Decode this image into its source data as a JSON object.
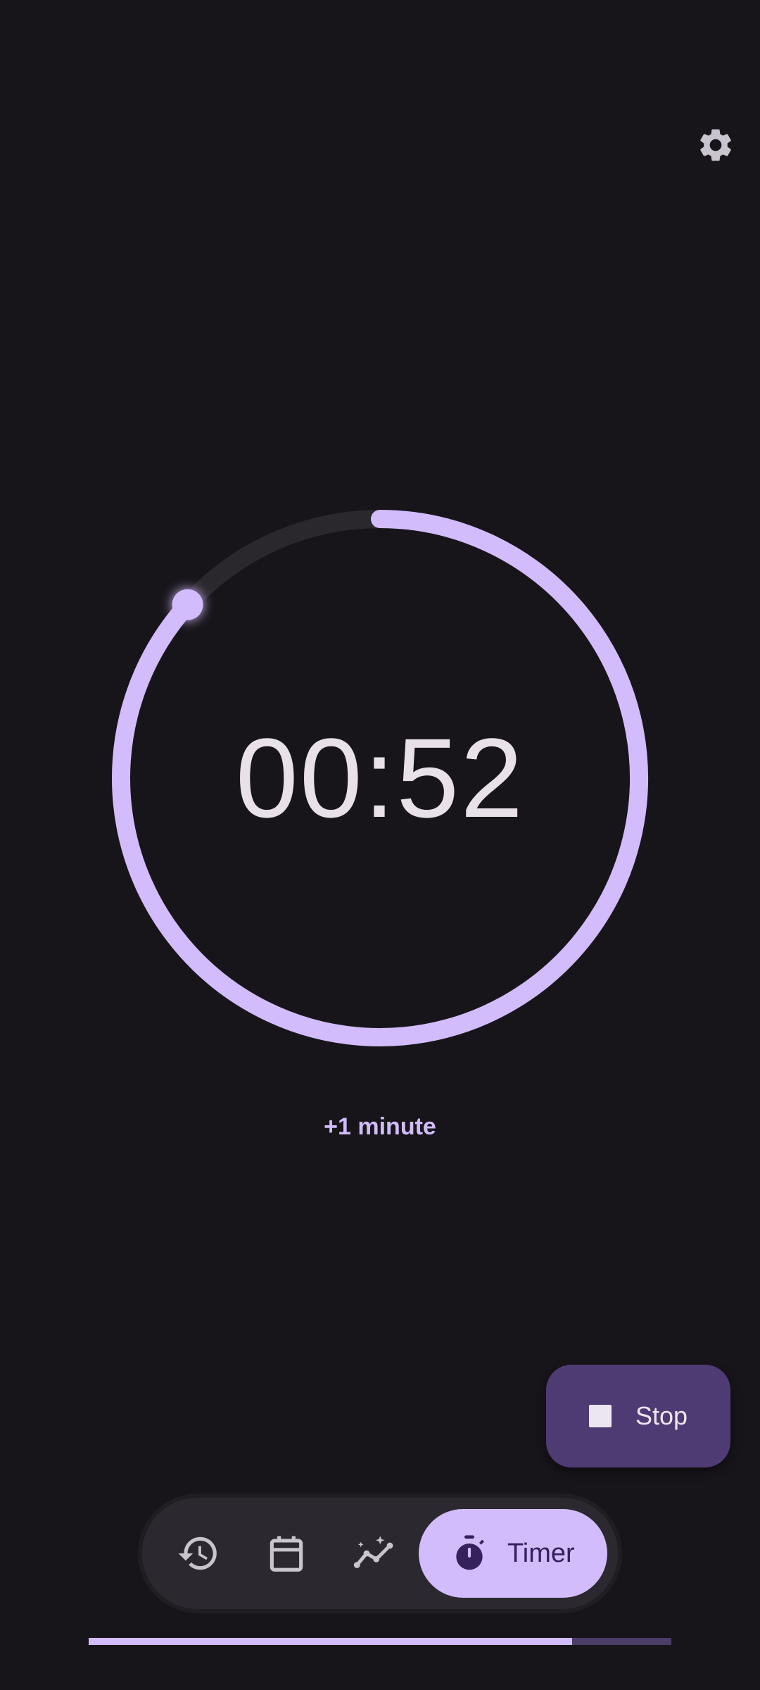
{
  "settings": {
    "icon": "gear-icon"
  },
  "timer": {
    "display": "00:52",
    "ring_progress": 0.8667,
    "ring_color": "#d2bcfb",
    "track_color": "#2a272d"
  },
  "actions": {
    "add_minute_label": "+1 minute",
    "stop_label": "Stop",
    "stop_icon": "stop-icon"
  },
  "nav": {
    "items": [
      {
        "name": "history",
        "icon": "history-icon"
      },
      {
        "name": "calendar",
        "icon": "calendar-icon"
      },
      {
        "name": "insights",
        "icon": "insights-icon"
      },
      {
        "name": "timer",
        "icon": "stopwatch-icon",
        "label": "Timer",
        "active": true
      }
    ]
  },
  "bottom_progress": {
    "value": 0.83,
    "fill_color": "#d2bcfb",
    "track_color": "#4a3d66"
  },
  "colors": {
    "background": "#17151a",
    "accent": "#d2bcfb",
    "fab": "#4f3b74"
  }
}
